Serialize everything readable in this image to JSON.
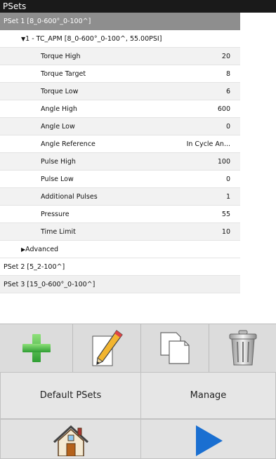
{
  "window": {
    "title": "PSets"
  },
  "psets": {
    "pset1": {
      "label": "PSet 1 [8_0-600°_0-100^]"
    },
    "step1": {
      "label": "1 - TC_APM [8_0-600°_0-100^, 55.00PSI]"
    },
    "params": [
      {
        "label": "Torque High",
        "value": "20"
      },
      {
        "label": "Torque Target",
        "value": "8"
      },
      {
        "label": "Torque Low",
        "value": "6"
      },
      {
        "label": "Angle High",
        "value": "600"
      },
      {
        "label": "Angle Low",
        "value": "0"
      },
      {
        "label": "Angle Reference",
        "value": "In Cycle An..."
      },
      {
        "label": "Pulse High",
        "value": "100"
      },
      {
        "label": "Pulse Low",
        "value": "0"
      },
      {
        "label": "Additional Pulses",
        "value": "1"
      },
      {
        "label": "Pressure",
        "value": "55"
      },
      {
        "label": "Time Limit",
        "value": "10"
      }
    ],
    "advanced": {
      "label": "Advanced"
    },
    "pset2": {
      "label": "PSet 2 [5_2-100^]"
    },
    "pset3": {
      "label": "PSet 3 [15_0-600°_0-100^]"
    }
  },
  "toolbar": {
    "add": "plus-icon",
    "edit": "pencil-icon",
    "copy": "copy-icon",
    "delete": "trash-icon"
  },
  "buttons": {
    "default_psets": "Default PSets",
    "manage": "Manage"
  },
  "nav": {
    "home": "home-icon",
    "play": "play-icon"
  },
  "colors": {
    "titlebar": "#1a1a1a",
    "selected_row": "#8e8e8e",
    "plus_green": "#39b54a",
    "play_blue": "#1a6fd1"
  }
}
